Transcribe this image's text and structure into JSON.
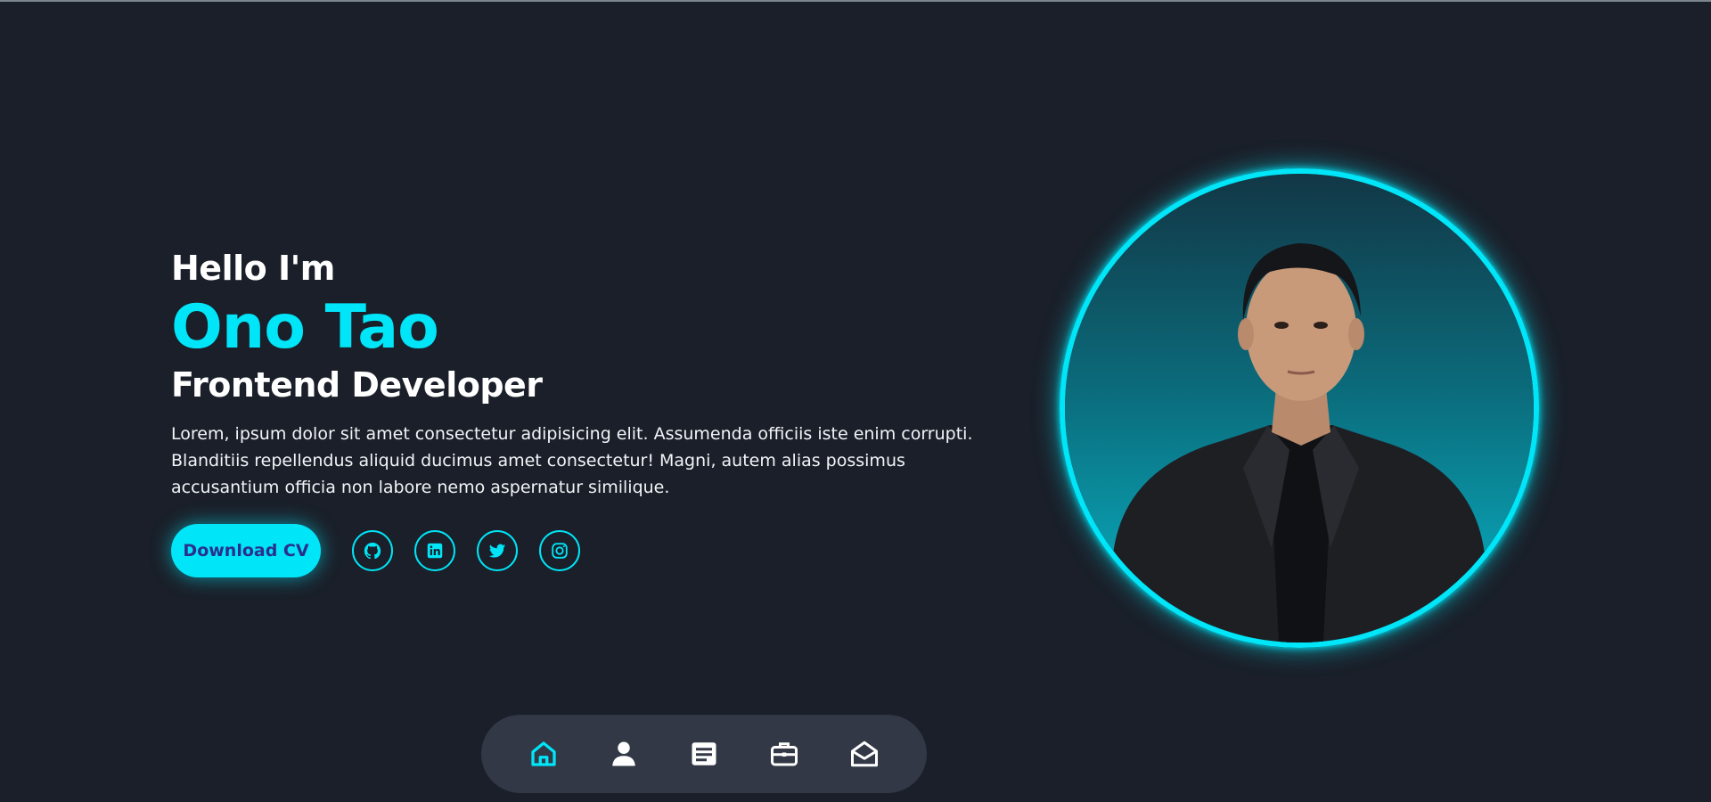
{
  "colors": {
    "background": "#1a1f29",
    "accent": "#00e5f7",
    "button_text": "#2a2f8f",
    "dock_background": "#323845",
    "text": "#ffffff"
  },
  "hero": {
    "greeting": "Hello I'm",
    "name": "Ono Tao",
    "role": "Frontend Developer",
    "bio": "Lorem, ipsum dolor sit amet consectetur adipisicing elit. Assumenda officiis iste enim corrupti. Blanditiis repellendus aliquid ducimus amet consectetur! Magni, autem alias possimus accusantium officia non labore nemo aspernatur similique.",
    "cv_button_label": "Download CV"
  },
  "socials": [
    {
      "icon": "github-icon"
    },
    {
      "icon": "linkedin-icon"
    },
    {
      "icon": "twitter-icon"
    },
    {
      "icon": "instagram-icon"
    }
  ],
  "dock": {
    "items": [
      {
        "icon": "home-icon",
        "active": true
      },
      {
        "icon": "user-icon",
        "active": false
      },
      {
        "icon": "article-icon",
        "active": false
      },
      {
        "icon": "briefcase-icon",
        "active": false
      },
      {
        "icon": "mail-open-icon",
        "active": false
      }
    ]
  }
}
